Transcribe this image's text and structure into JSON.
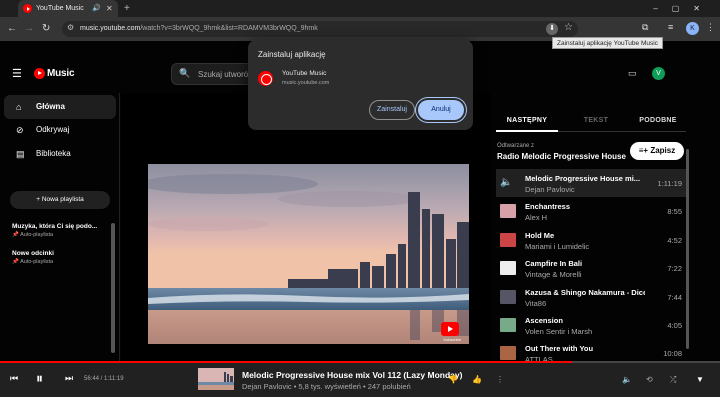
{
  "browser": {
    "tab_title": "YouTube Music",
    "url_host": "music.youtube.com",
    "url_path": "/watch?v=3brWQQ_9hmk&list=RDAMVM3brWQQ_9hmk",
    "profile_initial": "K",
    "tooltip": "Zainstaluj aplikację YouTube Music"
  },
  "header": {
    "logo_text": "Music",
    "search_placeholder": "Szukaj utworów",
    "user_initial": "V"
  },
  "sidebar": {
    "nav": [
      {
        "label": "Główna",
        "icon": "home-icon"
      },
      {
        "label": "Odkrywaj",
        "icon": "compass-icon"
      },
      {
        "label": "Biblioteka",
        "icon": "library-icon"
      }
    ],
    "new_playlist": "Nowa playlista",
    "playlists": [
      {
        "title": "Muzyka, która Ci się podo...",
        "subtitle": "Auto-playlista"
      },
      {
        "title": "Nowe odcinki",
        "subtitle": "Auto-playlista"
      }
    ]
  },
  "dialog": {
    "title": "Zainstaluj aplikację",
    "app_name": "YouTube Music",
    "app_url": "music.youtube.com",
    "install_label": "Zainstaluj",
    "cancel_label": "Anuluj"
  },
  "video": {
    "watermark_text": "Subscribe"
  },
  "panel": {
    "tabs": [
      "NASTĘPNY",
      "TEKST",
      "PODOBNE"
    ],
    "playing_from": "Odtwarzane z",
    "radio_name": "Radio Melodic Progressive House m...",
    "save_label": "Zapisz",
    "queue": [
      {
        "title": "Melodic Progressive House mi...",
        "artist": "Dejan Pavlovic",
        "duration": "1:11:19",
        "thumb": "#777"
      },
      {
        "title": "Enchantress",
        "artist": "Alex H",
        "duration": "8:55",
        "thumb": "#d8a0a8"
      },
      {
        "title": "Hold Me",
        "artist": "Mariami i Lumidelic",
        "duration": "4:52",
        "thumb": "#c44"
      },
      {
        "title": "Campfire In Bali",
        "artist": "Vintage & Morelli",
        "duration": "7:22",
        "thumb": "#eee"
      },
      {
        "title": "Kazusa & Shingo Nakamura - Dice",
        "artist": "Vita86",
        "duration": "7:44",
        "thumb": "#556"
      },
      {
        "title": "Ascension",
        "artist": "Volen Sentir i Marsh",
        "duration": "4:05",
        "thumb": "#7a8"
      },
      {
        "title": "Out There with You",
        "artist": "ATTLAS",
        "duration": "10:08",
        "thumb": "#a64"
      }
    ]
  },
  "player": {
    "time": "56:44 / 1:11:19",
    "progress": 0.795,
    "title": "Melodic Progressive House mix Vol 112 (Lazy Monday)",
    "subtitle": "Dejan Pavlovic • 5,8 tys. wyświetleń • 247 polubień"
  }
}
